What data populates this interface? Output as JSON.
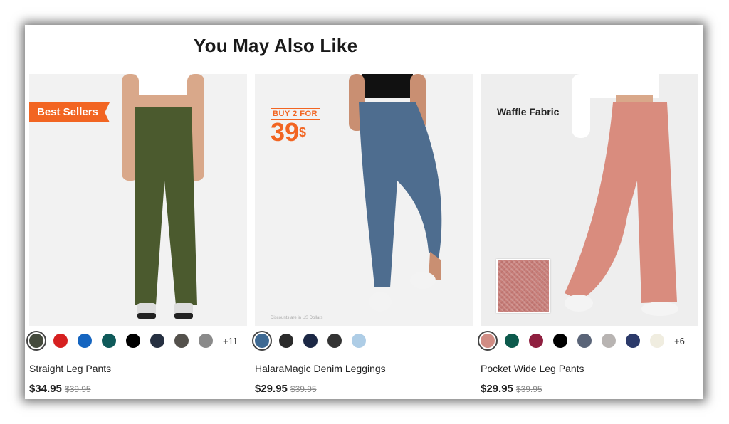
{
  "section": {
    "title": "You May Also Like"
  },
  "products": [
    {
      "name": "Straight Leg Pants",
      "price": "$34.95",
      "original_price": "$39.95",
      "badge": "Best Sellers",
      "swatches": [
        "#444a3c",
        "#d62020",
        "#1565c0",
        "#0f5a5a",
        "#000000",
        "#263041",
        "#54514c",
        "#8a8a8a"
      ],
      "more_colors": "+11"
    },
    {
      "name": "HalaraMagic Denim Leggings",
      "price": "$29.95",
      "original_price": "$39.95",
      "promo_top": "BUY 2 FOR",
      "promo_price": "39",
      "promo_currency": "$",
      "disclaimer": "Discounts are in US Dollars",
      "swatches": [
        "#3f6a93",
        "#2b2b2b",
        "#1c2845",
        "#333333",
        "#aecde6"
      ]
    },
    {
      "name": "Pocket Wide Leg Pants",
      "price": "$29.95",
      "original_price": "$39.95",
      "feature_label": "Waffle Fabric",
      "swatches": [
        "#d08c84",
        "#0d5a4c",
        "#8f1f3f",
        "#000000",
        "#5a6478",
        "#b8b4b2",
        "#2c3a6a",
        "#f0ede0"
      ],
      "more_colors": "+6"
    }
  ],
  "colors": {
    "accent": "#f26522"
  }
}
